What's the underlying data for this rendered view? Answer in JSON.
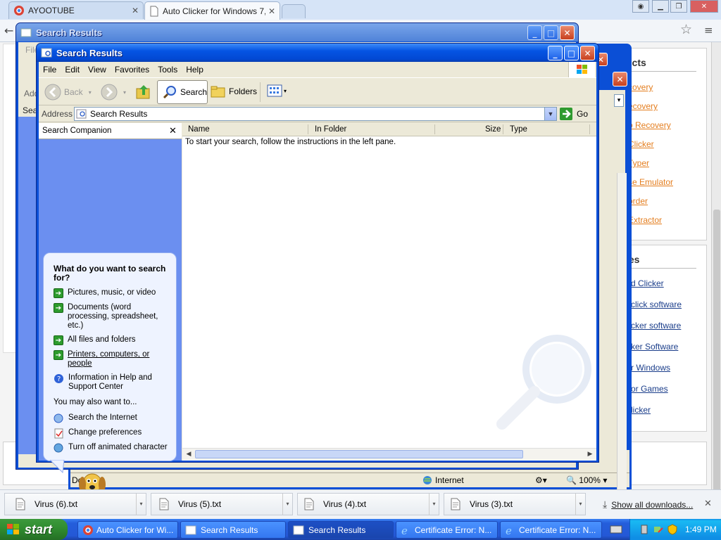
{
  "chrome": {
    "tabs": [
      {
        "title": "AYOOTUBE",
        "active": false
      },
      {
        "title": "Auto Clicker for Windows 7, ",
        "active": true
      }
    ]
  },
  "webpage": {
    "products_heading": "ucts",
    "product_links": [
      "covery",
      "ecovery",
      "o Recovery",
      "Clicker",
      "Typer",
      "se Emulator",
      "order",
      "Extractor"
    ],
    "articles_heading": "les",
    "article_links": [
      "d Clicker",
      "click software",
      "cker software",
      "ker Software",
      "r Windows",
      "or Games",
      "licker"
    ]
  },
  "ie": {
    "status": "Done",
    "zone": "Internet",
    "zoom": "100%"
  },
  "back_window": {
    "title": "Search Results",
    "menu_partial": "File",
    "addr_partial": "Add",
    "search_partial": "Sear"
  },
  "search_window": {
    "title": "Search Results",
    "menu": [
      "File",
      "Edit",
      "View",
      "Favorites",
      "Tools",
      "Help"
    ],
    "toolbar": {
      "back": "Back",
      "search": "Search",
      "folders": "Folders"
    },
    "address_label": "Address",
    "address_value": "Search Results",
    "go_label": "Go",
    "companion_title": "Search Companion",
    "question": "What do you want to search for?",
    "options": [
      "Pictures, music, or video",
      "Documents (word processing, spreadsheet, etc.)",
      "All files and folders",
      "Printers, computers, or people",
      "Information in Help and Support Center"
    ],
    "also_label": "You may also want to...",
    "also_options": [
      "Search the Internet",
      "Change preferences",
      "Turn off animated character"
    ],
    "columns": [
      "Name",
      "In Folder",
      "Size",
      "Type"
    ],
    "empty_message": "To start your search, follow the instructions in the left pane."
  },
  "downloads": {
    "items": [
      "Virus (6).txt",
      "Virus (5).txt",
      "Virus (4).txt",
      "Virus (3).txt"
    ],
    "show_all": "Show all downloads..."
  },
  "taskbar": {
    "start": "start",
    "items": [
      "Auto Clicker for Wi...",
      "Search Results",
      "Search Results",
      "Certificate Error: N...",
      "Certificate Error: N..."
    ],
    "clock": "1:49 PM"
  },
  "colors": {
    "xp_blue": "#0b4fd6",
    "link_orange": "#e47e1f",
    "companion_bg": "#6b8ff0"
  }
}
